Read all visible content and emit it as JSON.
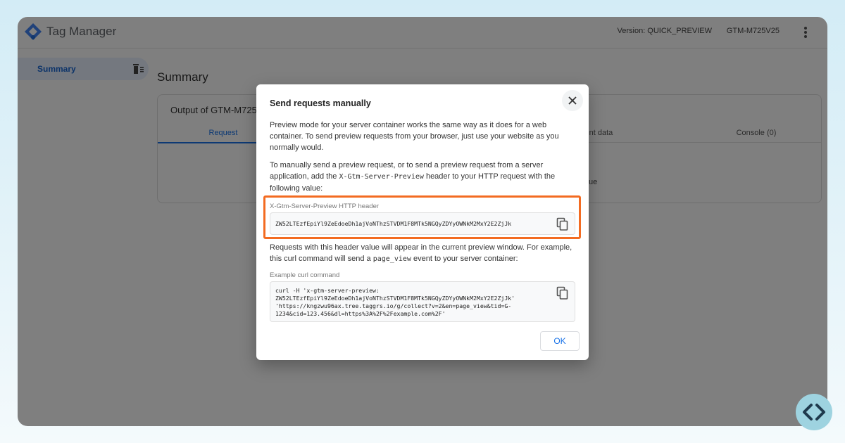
{
  "app": {
    "title": "Tag Manager",
    "version": "Version: QUICK_PREVIEW",
    "container_id": "GTM-M725V25"
  },
  "sidebar": {
    "items": [
      {
        "label": "Summary"
      }
    ]
  },
  "main": {
    "title": "Summary",
    "card_title": "Output of GTM-M725",
    "tabs": [
      {
        "label": "Request"
      },
      {
        "label": "Event data"
      },
      {
        "label": "Console (0)"
      }
    ],
    "hint_fragment": "ue"
  },
  "dialog": {
    "title": "Send requests manually",
    "para1": "Preview mode for your server container works the same way as it does for a web container. To send preview requests from your browser, just use your website as you normally would.",
    "para2_pre": "To manually send a preview request, or to send a preview request from a server application, add the ",
    "para2_code": "X-Gtm-Server-Preview",
    "para2_post": " header to your HTTP request with the following value:",
    "header_label": "X-Gtm-Server-Preview HTTP header",
    "header_value": "ZW52LTEzfEpiYl9ZeEdoeDh1ajVoNThzSTVDM1F8MTk5NGQyZDYyOWNkM2MxY2E2ZjJk",
    "para3_pre": "Requests with this header value will appear in the current preview window. For example, this curl command will send a ",
    "para3_code": "page_view",
    "para3_post": " event to your server container:",
    "curl_label": "Example curl command",
    "curl_lines": [
      "curl -H 'x-gtm-server-preview:",
      "ZW52LTEzfEpiYl9ZeEdoeDh1ajVoNThzSTVDM1F8MTk5NGQyZDYyOWNkM2MxY2E2ZjJk'",
      "'https://kngzwu96ax.tree.taggrs.io/g/collect?v=2&en=page_view&tid=G-",
      "1234&cid=123.456&dl=https%3A%2F%2Fexample.com%2F'"
    ],
    "ok_label": "OK"
  },
  "colors": {
    "accent": "#1a73e8",
    "highlight": "#f36b21",
    "brand_badge": "#9ed3e0",
    "overlay": "rgba(0,0,0,0.5)"
  },
  "icons": [
    "tag-manager-logo-icon",
    "more-vert-icon",
    "sidebar-filter-icon",
    "close-icon",
    "copy-icon",
    "code-brackets-icon"
  ]
}
